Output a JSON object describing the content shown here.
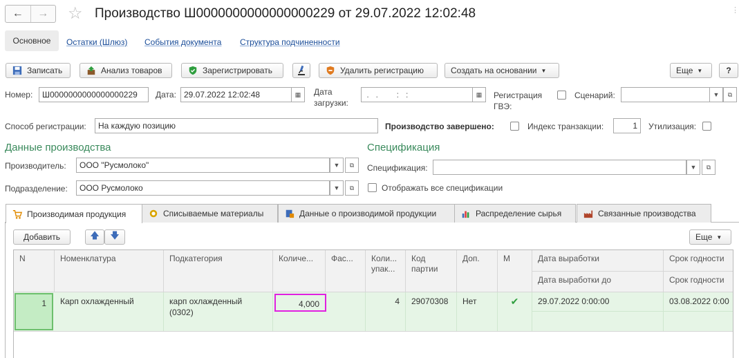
{
  "title": "Производство Ш0000000000000000229 от 29.07.2022 12:02:48",
  "nav_tabs": [
    "Основное",
    "Остатки (Шлюз)",
    "События документа",
    "Структура подчиненности"
  ],
  "toolbar": {
    "write": "Записать",
    "analysis": "Анализ товаров",
    "register": "Зарегистрировать",
    "delete_reg": "Удалить регистрацию",
    "create_based": "Создать на основании",
    "more": "Еще",
    "help": "?"
  },
  "fields": {
    "number_label": "Номер:",
    "number_value": "Ш0000000000000000229",
    "date_label": "Дата:",
    "date_value": "29.07.2022 12:02:48",
    "load_date_label_1": "Дата",
    "load_date_label_2": "загрузки:",
    "load_date_value": " .   .        :   :",
    "reg_gve_label_1": "Регистрация",
    "reg_gve_label_2": "ГВЭ:",
    "scenario_label": "Сценарий:",
    "scenario_value": "",
    "reg_method_label": "Способ регистрации:",
    "reg_method_value": "На каждую позицию",
    "prod_done_label": "Производство завершено:",
    "tx_index_label": "Индекс транзакции:",
    "tx_index_value": "1",
    "utilization_label": "Утилизация:"
  },
  "production": {
    "heading": "Данные производства",
    "producer_label": "Производитель:",
    "producer_value": "ООО \"Русмолоко\"",
    "division_label": "Подразделение:",
    "division_value": "ООО Русмолоко"
  },
  "spec": {
    "heading": "Спецификация",
    "spec_label": "Спецификация:",
    "spec_value": "",
    "show_all_label": "Отображать все спецификации"
  },
  "tabs": [
    "Производимая продукция",
    "Списываемые материалы",
    "Данные о производимой продукции",
    "Распределение сырья",
    "Связанные производства"
  ],
  "table_toolbar": {
    "add": "Добавить",
    "more": "Еще"
  },
  "table": {
    "headers": {
      "n": "N",
      "nomenclature": "Номенклатура",
      "subcategory": "Подкатегория",
      "qty": "Количе...",
      "packaging": "Фас...",
      "qty_pack_1": "Коли...",
      "qty_pack_2": "упак...",
      "batch_1": "Код",
      "batch_2": "партии",
      "extra": "Доп.",
      "m": "М",
      "prod_date": "Дата выработки",
      "prod_date_to": "Дата выработки до",
      "expiry": "Срок годности",
      "expiry2": "Срок годности"
    },
    "rows": [
      {
        "n": "1",
        "nomenclature": "Карп охлажденный",
        "subcategory_1": "карп охлажденный",
        "subcategory_2": "(0302)",
        "qty": "4,000",
        "packaging": "",
        "qty_pack": "4",
        "batch": "29070308",
        "extra": "Нет",
        "m": "✔",
        "prod_date": "29.07.2022 0:00:00",
        "expiry": "03.08.2022 0:00"
      }
    ]
  },
  "colors": {
    "accent_green": "#3a8a5c",
    "row_bg": "#e6f5e6",
    "highlight": "#e020e0",
    "link": "#1a4d99"
  }
}
